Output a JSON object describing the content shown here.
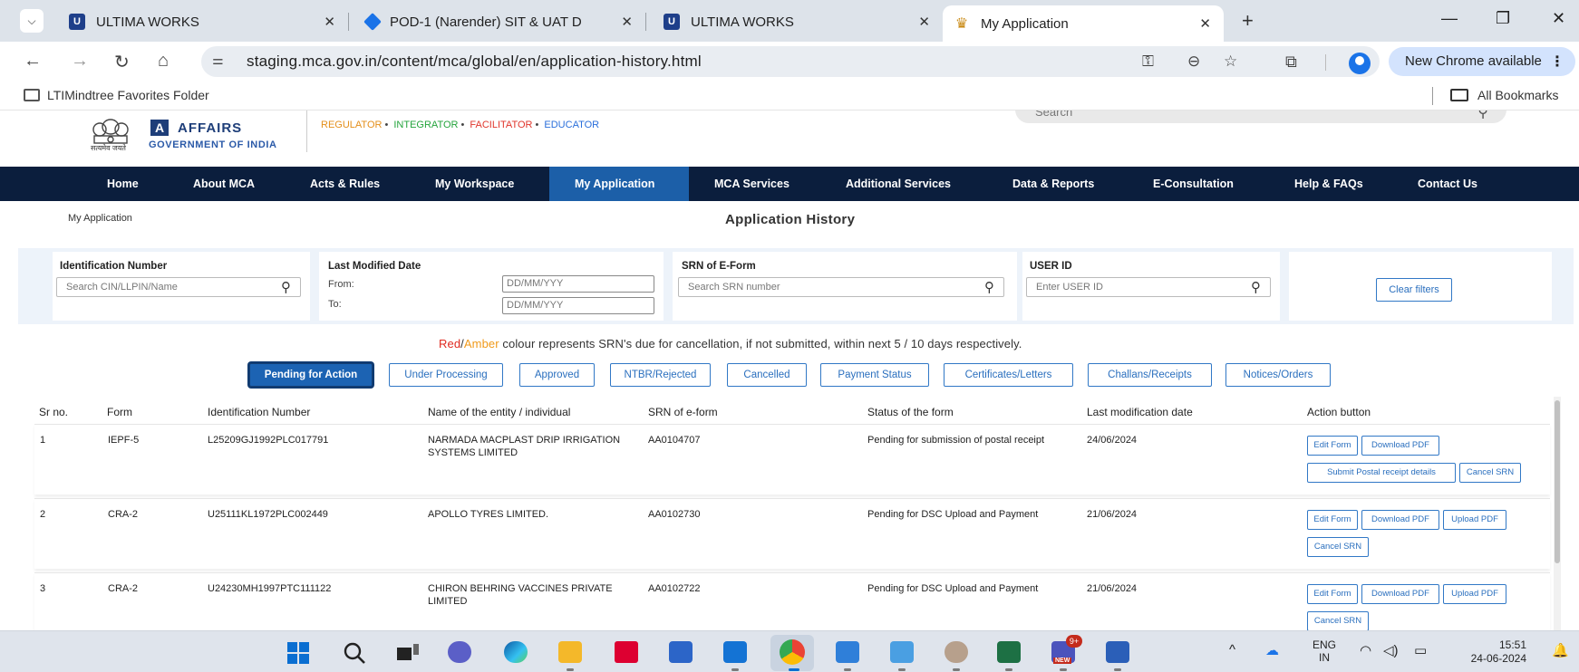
{
  "browser": {
    "tabs": [
      {
        "title": "ULTIMA WORKS",
        "favicon": "ultima-icon"
      },
      {
        "title": "POD-1 (Narender) SIT & UAT D",
        "favicon": "diamond-icon"
      },
      {
        "title": "ULTIMA WORKS",
        "favicon": "ultima-icon"
      },
      {
        "title": "My Application",
        "favicon": "emblem-icon"
      }
    ],
    "url": "staging.mca.gov.in/content/mca/global/en/application-history.html",
    "update_label": "New Chrome available",
    "bookmarks": {
      "folder": "LTIMindtree Favorites Folder",
      "all": "All Bookmarks"
    }
  },
  "site": {
    "emblem_caption": "सत्यमेव जयते",
    "logo_letter": "A",
    "logo_word": "AFFAIRS",
    "logo_sub": "GOVERNMENT OF INDIA",
    "tagline": [
      "REGULATOR",
      "INTEGRATOR",
      "FACILITATOR",
      "EDUCATOR"
    ],
    "search_placeholder": "Search",
    "nav": [
      "Home",
      "About MCA",
      "Acts & Rules",
      "My Workspace",
      "My Application",
      "MCA Services",
      "Additional Services",
      "Data & Reports",
      "E-Consultation",
      "Help & FAQs",
      "Contact Us"
    ],
    "active_nav": "My Application"
  },
  "page": {
    "breadcrumb": "My Application",
    "title": "Application History"
  },
  "filters": {
    "id_label": "Identification Number",
    "id_placeholder": "Search CIN/LLPIN/Name",
    "date_label": "Last Modified Date",
    "from_label": "From:",
    "to_label": "To:",
    "date_placeholder": "DD/MM/YYY",
    "srn_label": "SRN of E-Form",
    "srn_placeholder": "Search SRN number",
    "user_label": "USER ID",
    "user_placeholder": "Enter USER ID",
    "clear_label": "Clear filters"
  },
  "note": {
    "red": "Red",
    "slash": "/",
    "amber": "Amber",
    "rest": " colour represents SRN's due for cancellation, if not submitted, within next 5 / 10 days respectively."
  },
  "status_tabs": [
    "Pending for Action",
    "Under Processing",
    "Approved",
    "NTBR/Rejected",
    "Cancelled",
    "Payment Status",
    "Certificates/Letters",
    "Challans/Receipts",
    "Notices/Orders"
  ],
  "table": {
    "headers": [
      "Sr no.",
      "Form",
      "Identification Number",
      "Name of the entity / individual",
      "SRN of e-form",
      "Status of the form",
      "Last modification date",
      "Action button"
    ],
    "rows": [
      {
        "sr": "1",
        "form": "IEPF-5",
        "id": "L25209GJ1992PLC017791",
        "name": "NARMADA MACPLAST DRIP IRRIGATION SYSTEMS LIMITED",
        "srn": "AA0104707",
        "status": "Pending for submission of postal receipt",
        "date": "24/06/2024",
        "actions": [
          "Edit Form",
          "Download PDF",
          "Submit Postal receipt details",
          "Cancel SRN"
        ]
      },
      {
        "sr": "2",
        "form": "CRA-2",
        "id": "U25111KL1972PLC002449",
        "name": "APOLLO TYRES LIMITED.",
        "srn": "AA0102730",
        "status": "Pending for DSC Upload and Payment",
        "date": "21/06/2024",
        "actions": [
          "Edit Form",
          "Download PDF",
          "Upload PDF",
          "Cancel SRN"
        ]
      },
      {
        "sr": "3",
        "form": "CRA-2",
        "id": "U24230MH1997PTC111122",
        "name": "CHIRON BEHRING VACCINES PRIVATE LIMITED",
        "srn": "AA0102722",
        "status": "Pending for DSC Upload and Payment",
        "date": "21/06/2024",
        "actions": [
          "Edit Form",
          "Download PDF",
          "Upload PDF",
          "Cancel SRN"
        ]
      }
    ]
  },
  "taskbar": {
    "lang_top": "ENG",
    "lang_bottom": "IN",
    "time": "15:51",
    "date": "24-06-2024",
    "teams_badge": "9+",
    "teams_new": "NEW"
  },
  "colors": {
    "nav_bg": "#0b1e3d",
    "nav_active": "#1c5fa8",
    "accent": "#2a6fbe",
    "red": "#e02a20",
    "amber": "#f09a1a"
  }
}
